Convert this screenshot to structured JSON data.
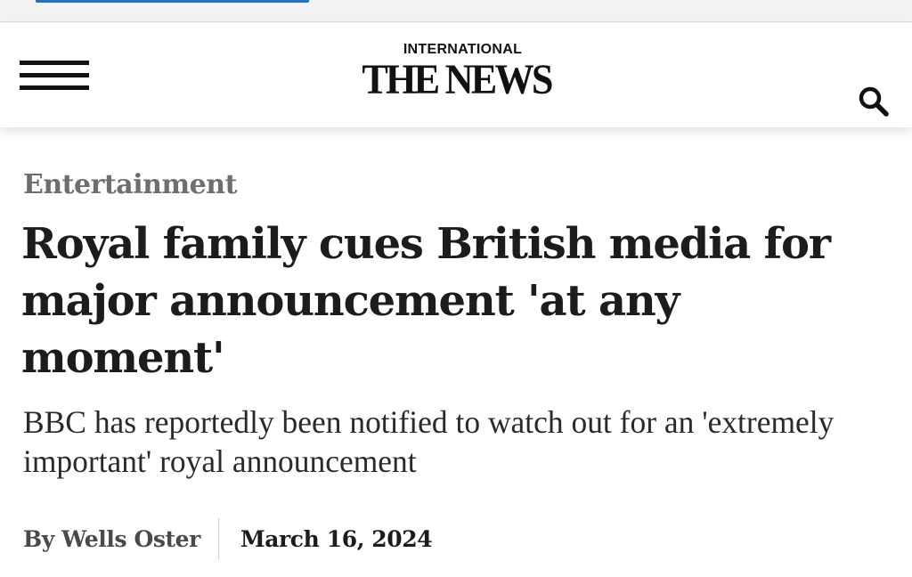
{
  "reading_progress": 0.3,
  "header": {
    "logo_top": "INTERNATIONAL",
    "logo_name": "THE NEWS",
    "menu_icon": "hamburger-menu-icon",
    "search_icon": "search-icon"
  },
  "article": {
    "category": "Entertainment",
    "headline": "Royal family cues British media for major announcement 'at any moment'",
    "subheadline": "BBC has reportedly been notified to watch out for an 'extremely important' royal announcement",
    "author": "By Wells Oster",
    "date": "March 16, 2024"
  },
  "colors": {
    "text": "#1c1c1c",
    "category": "#6e6e6e",
    "progress": "#2f6fb4"
  }
}
